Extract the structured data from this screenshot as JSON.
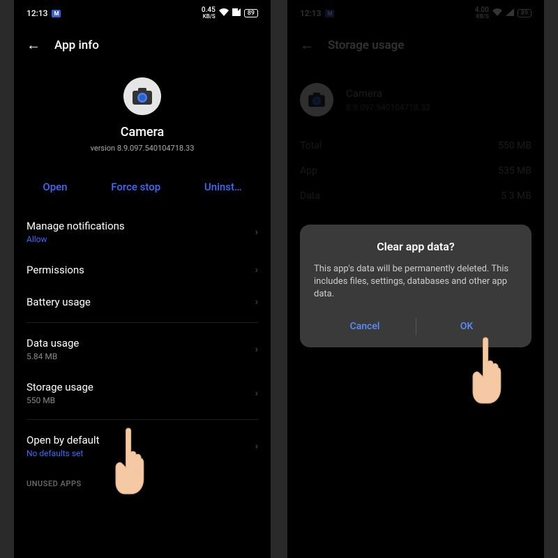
{
  "left": {
    "status": {
      "time": "12:13",
      "kbs_num": "0.45",
      "kbs_unit": "KB/S",
      "batt": "89"
    },
    "header": "App info",
    "app": {
      "name": "Camera",
      "version": "version 8.9.097.540104718.33"
    },
    "actions": {
      "open": "Open",
      "force_stop": "Force stop",
      "uninstall": "Uninst…"
    },
    "items": {
      "manage_notif": {
        "title": "Manage notifications",
        "sub": "Allow"
      },
      "permissions": {
        "title": "Permissions"
      },
      "battery": {
        "title": "Battery usage"
      },
      "data_usage": {
        "title": "Data usage",
        "sub": "5.84 MB"
      },
      "storage_usage": {
        "title": "Storage usage",
        "sub": "550 MB"
      },
      "open_default": {
        "title": "Open by default",
        "sub": "No defaults set"
      }
    },
    "section": "UNUSED APPS"
  },
  "right": {
    "status": {
      "time": "12:13",
      "kbs_num": "4.00",
      "kbs_unit": "KB/S",
      "batt": "89"
    },
    "header": "Storage usage",
    "app": {
      "name": "Camera",
      "version": "8.9.097.540104718.33"
    },
    "rows": {
      "total": {
        "label": "Total",
        "val": "550 MB"
      },
      "app": {
        "label": "App",
        "val": "535 MB"
      },
      "data": {
        "label": "Data",
        "val": "5.3 MB"
      }
    },
    "dialog": {
      "title": "Clear app data?",
      "body": "This app's data will be permanently deleted. This includes files, settings, databases and other app data.",
      "cancel": "Cancel",
      "ok": "OK"
    }
  }
}
